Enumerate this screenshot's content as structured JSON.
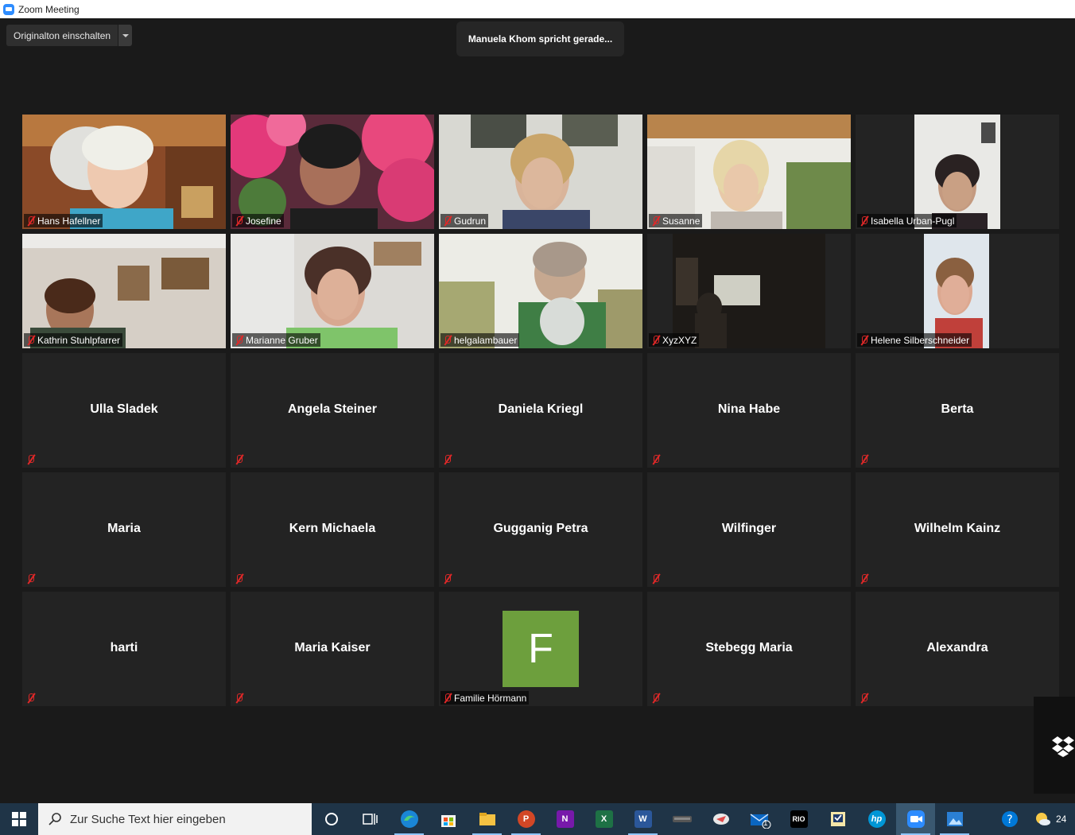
{
  "window": {
    "title": "Zoom Meeting"
  },
  "toolbar": {
    "original_audio_label": "Originalton einschalten"
  },
  "banner": {
    "speaking_text": "Manuela Khom spricht gerade..."
  },
  "participants": [
    {
      "name": "Hans Hafellner",
      "video": true
    },
    {
      "name": "Josefine",
      "video": true
    },
    {
      "name": "Gudrun",
      "video": true
    },
    {
      "name": "Susanne",
      "video": true
    },
    {
      "name": "Isabella Urban-Pugl",
      "video": true
    },
    {
      "name": "Kathrin Stuhlpfarrer",
      "video": true
    },
    {
      "name": "Marianne Gruber",
      "video": true
    },
    {
      "name": "helgalambauer",
      "video": true
    },
    {
      "name": "XyzXYZ",
      "video": true
    },
    {
      "name": "Helene Silberschneider",
      "video": true
    },
    {
      "name": "Ulla Sladek",
      "video": false
    },
    {
      "name": "Angela Steiner",
      "video": false
    },
    {
      "name": "Daniela Kriegl",
      "video": false
    },
    {
      "name": "Nina Habe",
      "video": false
    },
    {
      "name": "Berta",
      "video": false
    },
    {
      "name": "Maria",
      "video": false
    },
    {
      "name": "Kern Michaela",
      "video": false
    },
    {
      "name": "Gugganig Petra",
      "video": false
    },
    {
      "name": "Wilfinger",
      "video": false
    },
    {
      "name": "Wilhelm Kainz",
      "video": false
    },
    {
      "name": "harti",
      "video": false
    },
    {
      "name": "Maria Kaiser",
      "video": false
    },
    {
      "name": "Familie Hörmann",
      "video": false,
      "avatar_letter": "F"
    },
    {
      "name": "Stebegg Maria",
      "video": false
    },
    {
      "name": "Alexandra",
      "video": false
    }
  ],
  "taskbar": {
    "search_placeholder": "Zur Suche Text hier eingeben",
    "mail_badge": "1",
    "clock_fragment": "24",
    "rio_label": "RIO",
    "hp_label": "hp"
  },
  "colors": {
    "stage_bg": "#1a1a1a",
    "tile_bg": "#232323",
    "muted_red": "#e02828",
    "avatar_green": "#6d9f3d",
    "taskbar_bg": "#1f3447"
  }
}
